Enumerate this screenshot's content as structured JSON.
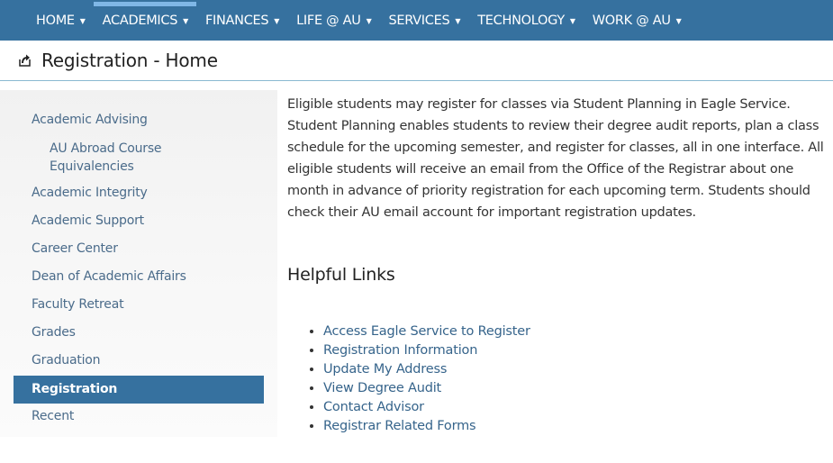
{
  "topnav": {
    "items": [
      {
        "label": "HOME",
        "caret": "▼"
      },
      {
        "label": "ACADEMICS",
        "caret": "▼",
        "active": true
      },
      {
        "label": "FINANCES",
        "caret": "▼"
      },
      {
        "label": "LIFE @ AU",
        "caret": "▼"
      },
      {
        "label": "SERVICES",
        "caret": "▼"
      },
      {
        "label": "TECHNOLOGY",
        "caret": "▼"
      },
      {
        "label": "WORK @ AU",
        "caret": "▼"
      }
    ]
  },
  "page": {
    "title": "Registration - Home",
    "title_icon": "share-export-icon"
  },
  "sidebar": {
    "items": [
      {
        "label": "Academic Advising"
      },
      {
        "label": "AU Abroad Course Equivalencies",
        "sub": true,
        "lines": [
          "AU Abroad Course",
          "Equivalencies"
        ]
      },
      {
        "label": "Academic Integrity"
      },
      {
        "label": "Academic Support"
      },
      {
        "label": "Career Center"
      },
      {
        "label": "Dean of Academic Affairs"
      },
      {
        "label": "Faculty Retreat"
      },
      {
        "label": "Grades"
      },
      {
        "label": "Graduation"
      },
      {
        "label": "Registration",
        "active": true
      },
      {
        "label": "Recent"
      }
    ]
  },
  "main": {
    "intro": "Eligible students may register for classes via Student Planning in Eagle Service. Student Planning enables students to review their degree audit reports, plan a class schedule for the upcoming semester, and register for classes, all in one interface. All eligible students will receive an email from the Office of the Registrar about one month in advance of priority registration for each upcoming term. Students should check their AU email account for important registration updates.",
    "helpful_links_heading": "Helpful Links",
    "links": [
      {
        "label": "Access Eagle Service to Register"
      },
      {
        "label": "Registration Information"
      },
      {
        "label": "Update My Address"
      },
      {
        "label": "View Degree Audit"
      },
      {
        "label": "Contact Advisor"
      },
      {
        "label": "Registrar Related Forms"
      }
    ]
  },
  "colors": {
    "nav_bg": "#36719f",
    "nav_active_indicator": "#7fb7e6",
    "link": "#36648b",
    "sidebar_link": "#4a6b8a",
    "sidebar_active_bg": "#36719f"
  }
}
